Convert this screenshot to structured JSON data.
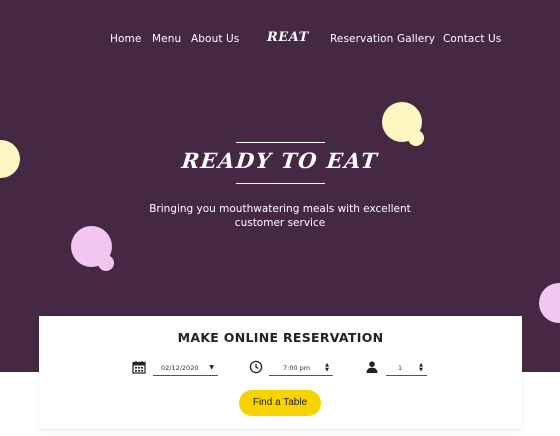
{
  "nav": {
    "left": [
      "Home",
      "Menu",
      "About Us"
    ],
    "logo": "REAT",
    "right": [
      "Reservation",
      "Gallery",
      "Contact Us"
    ]
  },
  "hero": {
    "title": "READY TO EAT",
    "subtitle": "Bringing you mouthwatering meals with excellent customer service"
  },
  "reservation": {
    "title": "MAKE ONLINE RESERVATION",
    "date_value": "02/12/2020",
    "time_value": "7:00 pm",
    "guests_value": "1",
    "button_label": "Find a Table"
  },
  "colors": {
    "hero_bg": "#452843",
    "accent_yellow": "#f7d300",
    "blob_cream": "#fff7c2",
    "blob_pink": "#f3c6f2"
  },
  "icons": [
    "calendar-icon",
    "clock-icon",
    "person-icon"
  ]
}
